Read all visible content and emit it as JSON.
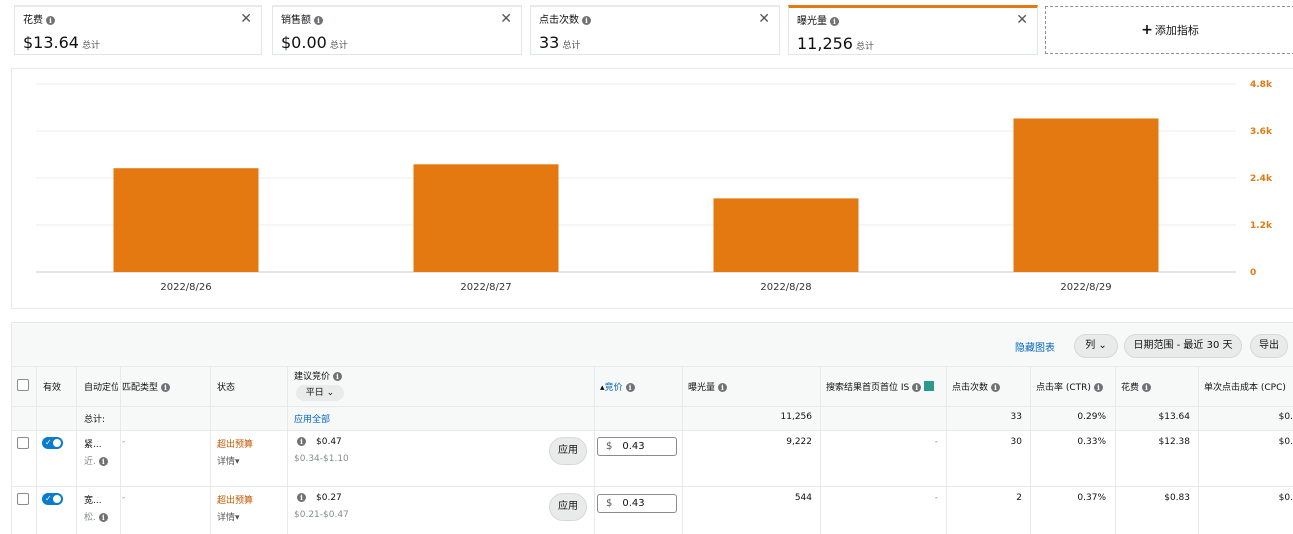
{
  "metric_cards": [
    {
      "label": "花费",
      "value": "$13.64",
      "total": "总计"
    },
    {
      "label": "销售额",
      "value": "$0.00",
      "total": "总计"
    },
    {
      "label": "点击次数",
      "value": "33",
      "total": "总计"
    },
    {
      "label": "曝光量",
      "value": "11,256",
      "total": "总计"
    }
  ],
  "add_metric": {
    "plus": "+",
    "label": "添加指标"
  },
  "chart_data": {
    "type": "bar",
    "categories": [
      "2022/8/26",
      "2022/8/27",
      "2022/8/28",
      "2022/8/29"
    ],
    "values": [
      2650,
      2750,
      1880,
      3920
    ],
    "y_ticks": [
      "0",
      "1.2k",
      "2.4k",
      "3.6k",
      "4.8k"
    ],
    "ylim": [
      0,
      4800
    ],
    "bar_color": "#e47911",
    "axis_label_color": "#e47911",
    "grid": true
  },
  "toolbar": {
    "hide_chart": "隐藏图表",
    "columns": "列",
    "date_range": "日期范围 - 最近 30 天",
    "export": "导出"
  },
  "table": {
    "headers": {
      "active": "有效",
      "auto_targeting": "自动定位",
      "match_type": "匹配类型",
      "status": "状态",
      "suggested_bid": "建议竞价",
      "weekday": "平日",
      "bid": "竞价",
      "impressions": "曝光量",
      "top_of_search": "搜索结果首页首位 IS",
      "clicks": "点击次数",
      "ctr": "点击率 (CTR)",
      "spend": "花费",
      "cpc": "单次点击成本 (CPC)"
    },
    "totals": {
      "label": "总计:",
      "apply_all": "应用全部",
      "impressions": "11,256",
      "clicks": "33",
      "ctr": "0.29%",
      "spend": "$13.64",
      "cpc": "$0."
    },
    "rows": [
      {
        "target_line1": "紧...",
        "target_line2": "近.",
        "match_type": "-",
        "status": "超出预算",
        "details": "详情",
        "suggested_bid": "$0.47",
        "bid_range": "$0.34-$1.10",
        "apply": "应用",
        "currency": "$",
        "bid": "0.43",
        "impressions": "9,222",
        "top_of_search": "-",
        "clicks": "30",
        "ctr": "0.33%",
        "spend": "$12.38",
        "cpc": "$0."
      },
      {
        "target_line1": "宽...",
        "target_line2": "松.",
        "match_type": "-",
        "status": "超出预算",
        "details": "详情",
        "suggested_bid": "$0.27",
        "bid_range": "$0.21-$0.47",
        "apply": "应用",
        "currency": "$",
        "bid": "0.43",
        "impressions": "544",
        "top_of_search": "-",
        "clicks": "2",
        "ctr": "0.37%",
        "spend": "$0.83",
        "cpc": "$0."
      }
    ]
  }
}
